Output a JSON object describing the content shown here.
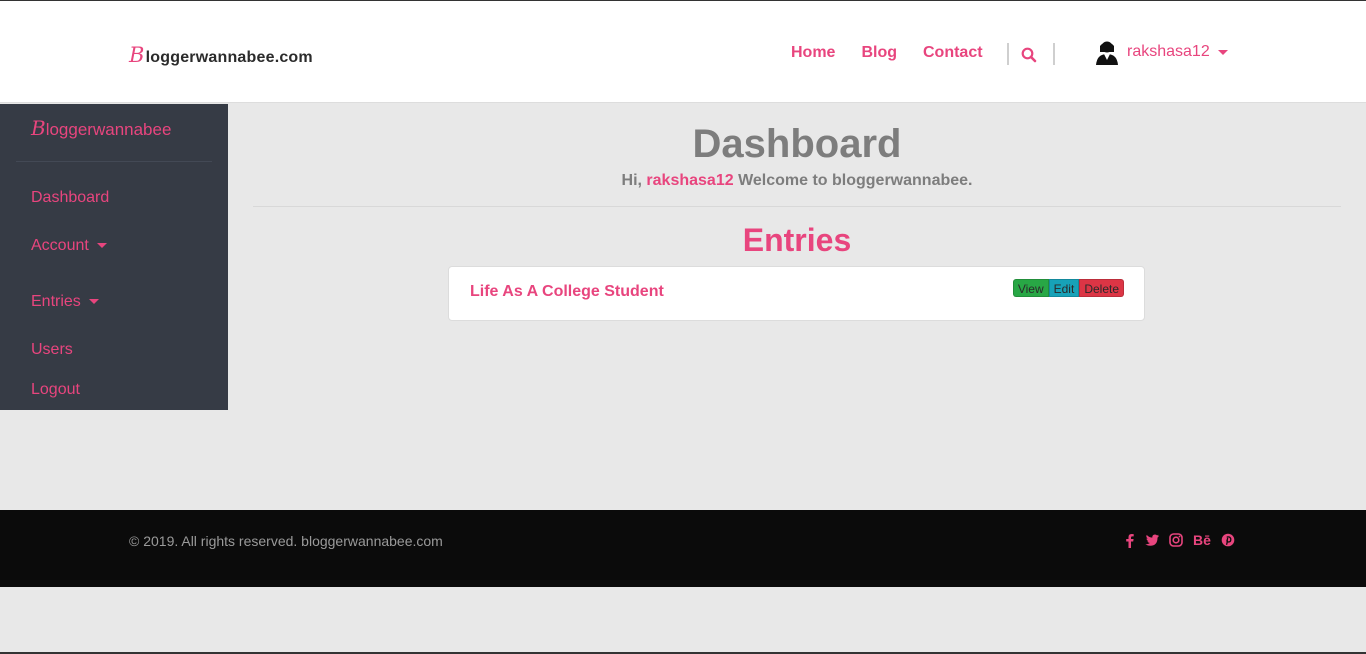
{
  "header": {
    "brand_initial": "B",
    "brand_rest": "loggerwannabee.com",
    "nav": [
      "Home",
      "Blog",
      "Contact"
    ],
    "user_name": "rakshasa12"
  },
  "sidebar": {
    "brand_initial": "B",
    "brand_rest": "loggerwannabee",
    "items": [
      {
        "label": "Dashboard",
        "dropdown": false
      },
      {
        "label": "Account",
        "dropdown": true
      },
      {
        "label": "Entries",
        "dropdown": true
      },
      {
        "label": "Users",
        "dropdown": false
      },
      {
        "label": "Logout",
        "dropdown": false
      }
    ]
  },
  "main": {
    "title": "Dashboard",
    "greeting_prefix": "Hi,",
    "greeting_user": "rakshasa12",
    "greeting_suffix": "Welcome to bloggerwannabee.",
    "entries_title": "Entries",
    "entries": [
      {
        "title": "Life As A College Student",
        "view_label": "View",
        "edit_label": "Edit",
        "delete_label": "Delete"
      }
    ]
  },
  "footer": {
    "copyright": "© 2019. All rights reserved. bloggerwannabee.com",
    "socials": [
      "facebook-icon",
      "twitter-icon",
      "instagram-icon",
      "behance-icon",
      "pinterest-icon"
    ],
    "behance_text": "Bē"
  },
  "colors": {
    "accent": "#e8457e",
    "sidebar_bg": "#363b45",
    "footer_bg": "#0b0b0b",
    "view": "#28a745",
    "edit": "#17a2b8",
    "delete": "#dc3545"
  }
}
